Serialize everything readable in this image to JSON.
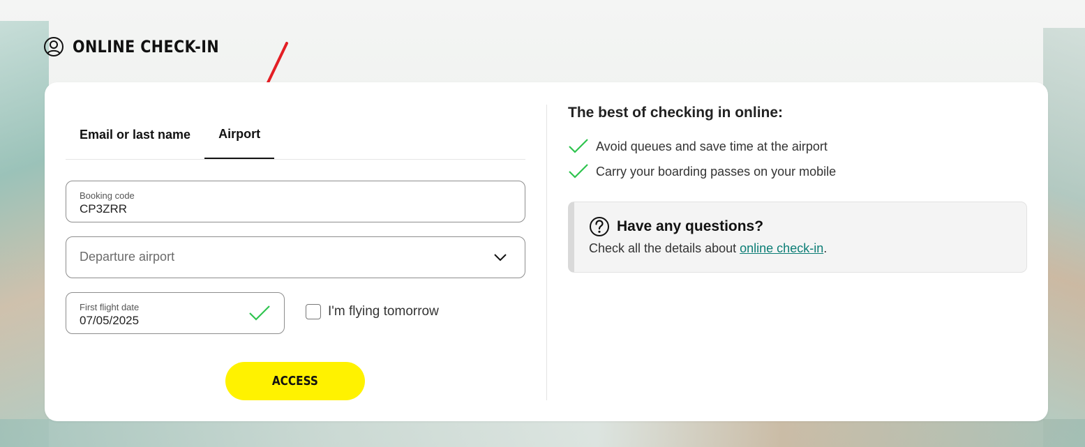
{
  "header": {
    "title": "ONLINE CHECK-IN",
    "icon": "user-circle-icon"
  },
  "tabs": [
    {
      "label": "Email or last name",
      "active": false
    },
    {
      "label": "Airport",
      "active": true
    }
  ],
  "form": {
    "booking_code": {
      "label": "Booking code",
      "value": "CP3ZRR"
    },
    "departure_airport": {
      "placeholder": "Departure airport",
      "value": ""
    },
    "first_flight_date": {
      "label": "First flight date",
      "value": "07/05/2025",
      "valid": true
    },
    "flying_tomorrow": {
      "label": "I'm flying tomorrow",
      "checked": false
    },
    "submit_label": "ACCESS"
  },
  "benefits": {
    "title": "The best of checking in online:",
    "items": [
      "Avoid queues and save time at the airport",
      "Carry your boarding passes on your mobile"
    ]
  },
  "faq": {
    "title": "Have any questions?",
    "text_prefix": "Check all the details about ",
    "link_text": "online check-in",
    "text_suffix": "."
  },
  "colors": {
    "accent_yellow": "#fff200",
    "check_green": "#2ec44e",
    "link_teal": "#0b7d75",
    "annotation_arrow_red": "#e31e24"
  }
}
